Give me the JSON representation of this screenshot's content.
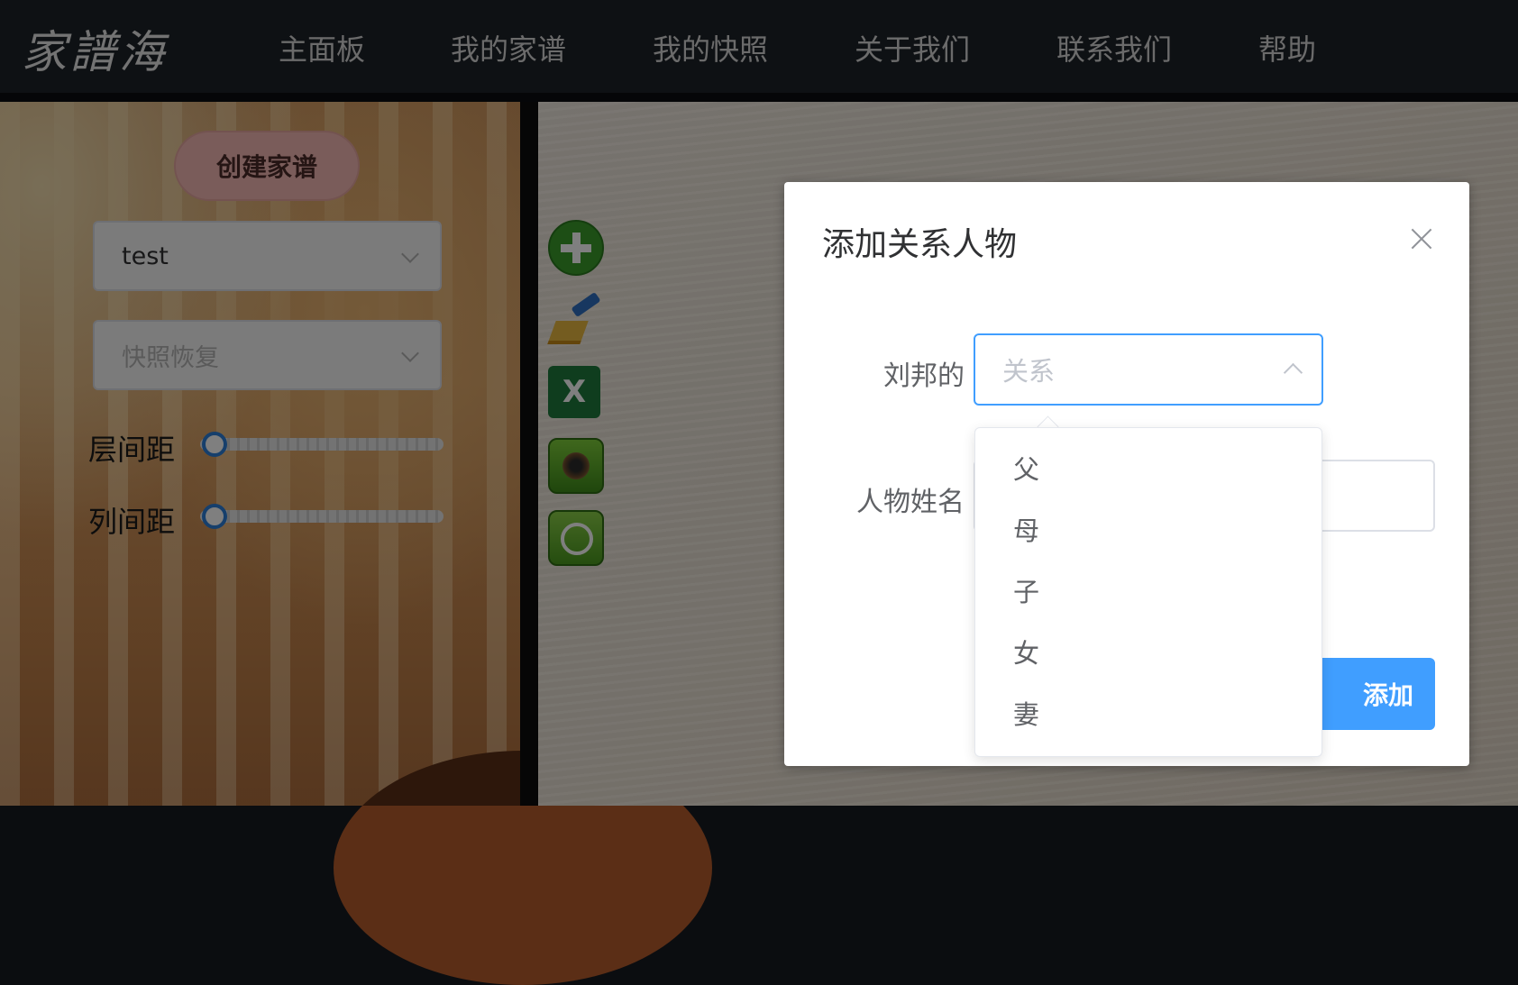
{
  "app": {
    "logo_text": "家譜海"
  },
  "nav": {
    "items": [
      {
        "label": "主面板"
      },
      {
        "label": "我的家谱"
      },
      {
        "label": "我的快照"
      },
      {
        "label": "关于我们"
      },
      {
        "label": "联系我们"
      },
      {
        "label": "帮助"
      }
    ]
  },
  "sidebar": {
    "create_label": "创建家谱",
    "tree_select": {
      "value": "test"
    },
    "snapshot_select": {
      "placeholder": "快照恢复"
    },
    "sliders": [
      {
        "label": "层间距",
        "value": 0
      },
      {
        "label": "列间距",
        "value": 0
      }
    ]
  },
  "toolbar": {
    "tools": [
      {
        "icon": "add-icon"
      },
      {
        "icon": "broom-icon"
      },
      {
        "icon": "excel-icon",
        "glyph": "X"
      },
      {
        "icon": "camera-icon"
      },
      {
        "icon": "history-icon"
      }
    ]
  },
  "dialog": {
    "title": "添加关系人物",
    "relation_label": "刘邦的",
    "relation_placeholder": "关系",
    "name_label": "人物姓名",
    "submit_label": "添加"
  },
  "dropdown": {
    "options": [
      "父",
      "母",
      "子",
      "女",
      "妻"
    ]
  },
  "colors": {
    "primary": "#409eff",
    "nav_bg": "#1d2228",
    "create_button": "#f4b9b4"
  }
}
